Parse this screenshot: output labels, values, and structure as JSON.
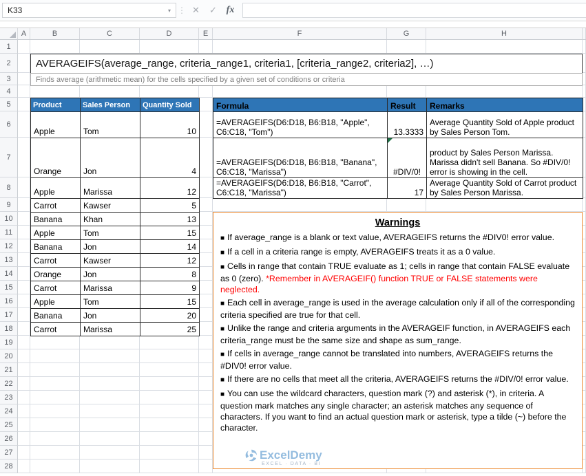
{
  "formula_bar": {
    "name_box": "K33",
    "dropdown_icon": "▾",
    "splitter_icon": "⋮",
    "cancel_icon": "✕",
    "enter_icon": "✓",
    "fx_icon": "fx",
    "formula_value": ""
  },
  "grid": {
    "col_letters": [
      "A",
      "B",
      "C",
      "D",
      "E",
      "F",
      "G",
      "H"
    ],
    "row_numbers": [
      "1",
      "2",
      "3",
      "4",
      "5",
      "6",
      "7",
      "8",
      "9",
      "10",
      "11",
      "12",
      "13",
      "14",
      "15",
      "16",
      "17",
      "18",
      "19",
      "20",
      "21",
      "22",
      "23",
      "24",
      "25",
      "26",
      "27",
      "28"
    ]
  },
  "title": "AVERAGEIFS(average_range, criteria_range1, criteria1, [criteria_range2, criteria2], …)",
  "subtitle": "Finds average (arithmetic mean) for the cells specified by a given set of conditions or criteria",
  "product_table": {
    "headers": [
      "Product",
      "Sales Person",
      "Quantity Sold"
    ],
    "rows": [
      {
        "product": "Apple",
        "person": "Tom",
        "qty": "10"
      },
      {
        "product": "Orange",
        "person": "Jon",
        "qty": "4"
      },
      {
        "product": "Apple",
        "person": "Marissa",
        "qty": "12"
      },
      {
        "product": "Carrot",
        "person": "Kawser",
        "qty": "5"
      },
      {
        "product": "Banana",
        "person": "Khan",
        "qty": "13"
      },
      {
        "product": "Apple",
        "person": "Tom",
        "qty": "15"
      },
      {
        "product": "Banana",
        "person": "Jon",
        "qty": "14"
      },
      {
        "product": "Carrot",
        "person": "Kawser",
        "qty": "12"
      },
      {
        "product": "Orange",
        "person": "Jon",
        "qty": "8"
      },
      {
        "product": "Carrot",
        "person": "Marissa",
        "qty": "9"
      },
      {
        "product": "Apple",
        "person": "Tom",
        "qty": "15"
      },
      {
        "product": "Banana",
        "person": "Jon",
        "qty": "20"
      },
      {
        "product": "Carrot",
        "person": "Marissa",
        "qty": "25"
      }
    ]
  },
  "formula_table": {
    "headers": [
      "Formula",
      "Result",
      "Remarks"
    ],
    "rows": [
      {
        "formula": "=AVERAGEIFS(D6:D18, B6:B18, \"Apple\", C6:C18, \"Tom\")",
        "result": "13.3333",
        "remarks": "Average Quantity Sold of Apple product by Sales Person Tom."
      },
      {
        "formula": "=AVERAGEIFS(D6:D18, B6:B18, \"Banana\", C6:C18, \"Marissa\")",
        "result": "#DIV/0!",
        "remarks": "product by Sales Person Marissa. Marissa didn't sell Banana. So #DIV/0! error is showing in the cell."
      },
      {
        "formula": "=AVERAGEIFS(D6:D18, B6:B18, \"Carrot\", C6:C18, \"Marissa\")",
        "result": "17",
        "remarks": "Average Quantity Sold of Carrot product by Sales Person Marissa."
      }
    ]
  },
  "warnings": {
    "title": "Warnings",
    "bullet": "■",
    "items": [
      {
        "text": "If average_range is a blank or text value, AVERAGEIFS returns the #DIV0! error value."
      },
      {
        "text": "If a cell in a criteria range is empty, AVERAGEIFS treats it as a 0 value."
      },
      {
        "text": "Cells in range that contain TRUE evaluate as 1; cells in range that contain FALSE evaluate as 0 (zero). ",
        "red_text": "*Remember in AVERAGEIF() function TRUE or FALSE statements were neglected."
      },
      {
        "text": "Each cell in average_range is used in the average calculation only if all of the corresponding criteria specified are true for that cell."
      },
      {
        "text": "Unlike the range and criteria arguments in the AVERAGEIF function, in AVERAGEIFS each criteria_range must be the same size and shape as sum_range."
      },
      {
        "text": "If cells in average_range cannot be translated into numbers, AVERAGEIFS returns the #DIV0! error value."
      },
      {
        "text": "If there are no cells that meet all the criteria, AVERAGEIFS returns the #DIV/0! error value."
      },
      {
        "text": "You can use the wildcard characters, question mark (?) and asterisk (*), in criteria. A question mark matches any single character; an asterisk matches any sequence of characters. If you want to find an actual question mark or asterisk, type a tilde (~) before the character."
      }
    ]
  },
  "watermark": {
    "name": "ExcelDemy",
    "tagline": "EXCEL · DATA · BI"
  },
  "colors": {
    "header_blue": "#2E75B6",
    "warning_border": "#ED8C32",
    "error_indicator_green": "#1E7145",
    "warning_red": "#FF0000"
  }
}
